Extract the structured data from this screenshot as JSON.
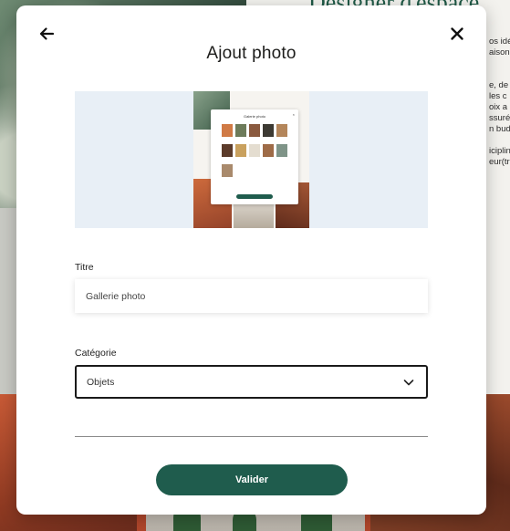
{
  "background_page": {
    "heading": "Designer d'espace",
    "lines": [
      "os idé",
      "aison",
      "",
      "e, de",
      "les c",
      "oix a",
      "ssuré",
      "n bud",
      "",
      "iciplin",
      "eur(tr"
    ]
  },
  "modal": {
    "title": "Ajout photo",
    "back_icon": "arrow-left-icon",
    "close_icon": "close-icon",
    "preview": {
      "thumbnail_modal_title": "Galerie photo",
      "thumbnail_close": "×"
    },
    "fields": {
      "title": {
        "label": "Titre",
        "value": "Gallerie photo"
      },
      "category": {
        "label": "Catégorie",
        "value": "Objets",
        "icon": "chevron-down-icon"
      }
    },
    "submit_label": "Valider"
  },
  "colors": {
    "accent": "#1f5c4d",
    "preview_bg": "#e8eff6"
  }
}
